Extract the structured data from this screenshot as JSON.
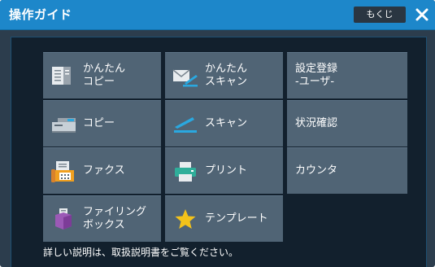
{
  "header": {
    "title": "操作ガイド",
    "mokuji_label": "もくじ"
  },
  "buttons": [
    {
      "label": "かんたん\nコピー",
      "icon": "easy-copy-icon"
    },
    {
      "label": "かんたん\nスキャン",
      "icon": "easy-scan-icon"
    },
    {
      "label": "設定登録\n-ユーザ-",
      "icon": ""
    },
    {
      "label": "コピー",
      "icon": "copier-icon"
    },
    {
      "label": "スキャン",
      "icon": "scan-icon"
    },
    {
      "label": "状況確認",
      "icon": ""
    },
    {
      "label": "ファクス",
      "icon": "fax-icon"
    },
    {
      "label": "プリント",
      "icon": "printer-icon"
    },
    {
      "label": "カウンタ",
      "icon": ""
    },
    {
      "label": "ファイリング\nボックス",
      "icon": "filing-box-icon"
    },
    {
      "label": "テンプレート",
      "icon": "star-icon"
    }
  ],
  "footer": {
    "note": "詳しい説明は、取扱説明書をご覧ください。"
  }
}
